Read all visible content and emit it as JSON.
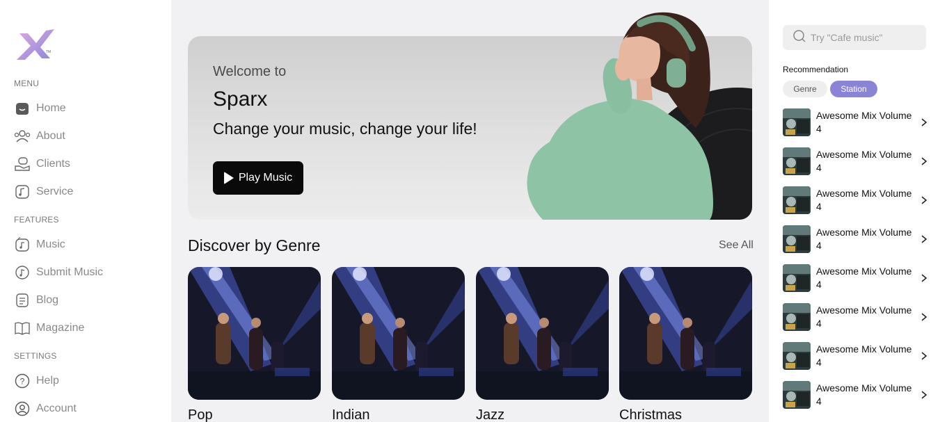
{
  "brand": {
    "logo_name": "sparx-x-logo"
  },
  "sidebar": {
    "menu_label": "MENU",
    "features_label": "FEATURES",
    "settings_label": "SETTINGS",
    "menu_items": [
      {
        "label": "Home",
        "icon": "home-icon"
      },
      {
        "label": "About",
        "icon": "users-icon"
      },
      {
        "label": "Clients",
        "icon": "handshake-icon"
      },
      {
        "label": "Service",
        "icon": "music-note-icon"
      }
    ],
    "feature_items": [
      {
        "label": "Music",
        "icon": "music-box-icon"
      },
      {
        "label": "Submit Music",
        "icon": "upload-music-icon"
      },
      {
        "label": "Blog",
        "icon": "document-icon"
      },
      {
        "label": "Magazine",
        "icon": "book-icon"
      }
    ],
    "settings_items": [
      {
        "label": "Help",
        "icon": "help-icon"
      },
      {
        "label": "Account",
        "icon": "account-icon"
      }
    ]
  },
  "hero": {
    "welcome": "Welcome to",
    "title": "Sparx",
    "tagline": "Change your music, change your life!",
    "button_label": "Play Music"
  },
  "discover": {
    "heading": "Discover by Genre",
    "see_all": "See All",
    "genres": [
      "Pop",
      "Indian",
      "Jazz",
      "Christmas"
    ]
  },
  "rightpanel": {
    "search_placeholder": "Try \"Cafe music\"",
    "recommendation_title": "Recommendation",
    "chips": {
      "genre": "Genre",
      "station": "Station"
    },
    "items": [
      "Awesome Mix Volume 4",
      "Awesome Mix Volume 4",
      "Awesome Mix Volume 4",
      "Awesome Mix Volume 4",
      "Awesome Mix Volume 4",
      "Awesome Mix Volume 4",
      "Awesome Mix Volume 4",
      "Awesome Mix Volume 4"
    ]
  },
  "colors": {
    "accent": "#8b83d6",
    "button": "#0a0a0a",
    "background": "#f1f1f4"
  }
}
